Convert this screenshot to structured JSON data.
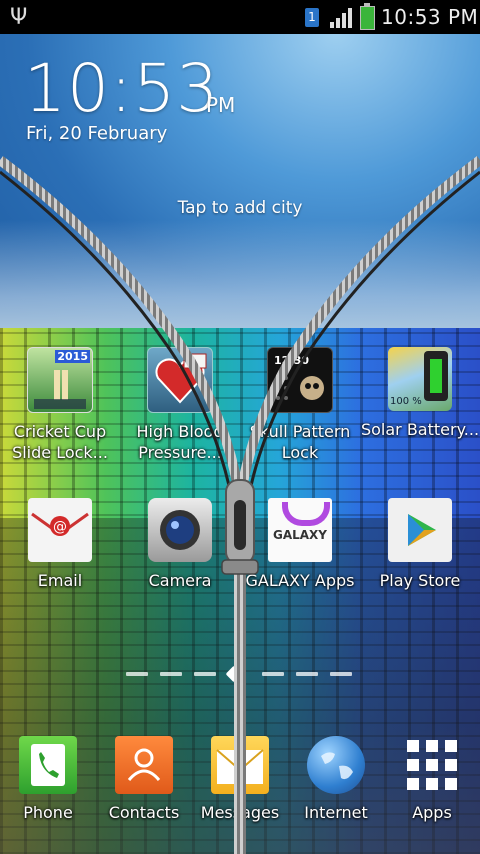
{
  "statusbar": {
    "time": "10:53 PM",
    "sim": "1"
  },
  "clock": {
    "time": "10:53",
    "ampm": "PM",
    "date": "Fri, 20 February"
  },
  "weather": {
    "prompt": "Tap to add city"
  },
  "apps_row1": [
    {
      "label": "Cricket Cup Slide Lock...",
      "badge": "2015",
      "icon": "cricket-icon"
    },
    {
      "label": "High Blood Pressure...",
      "icon": "heart-icon"
    },
    {
      "label": "Skull Pattern Lock",
      "badge": "12:30",
      "icon": "skull-icon"
    },
    {
      "label": "Solar Battery...",
      "badge": "100 %",
      "icon": "solar-battery-icon"
    }
  ],
  "apps_row2": [
    {
      "label": "Email",
      "icon": "email-icon"
    },
    {
      "label": "Camera",
      "icon": "camera-icon"
    },
    {
      "label": "GALAXY Apps",
      "badge": "GALAXY",
      "icon": "galaxy-apps-icon"
    },
    {
      "label": "Play Store",
      "icon": "play-store-icon"
    }
  ],
  "dock": [
    {
      "label": "Phone",
      "icon": "phone-icon"
    },
    {
      "label": "Contacts",
      "icon": "contacts-icon"
    },
    {
      "label": "Messages",
      "icon": "messages-icon"
    },
    {
      "label": "Internet",
      "icon": "globe-icon"
    },
    {
      "label": "Apps",
      "icon": "apps-grid-icon"
    }
  ],
  "colors": {
    "sky": "#2b6fb6",
    "statusbar": "#000000",
    "battery": "#3bb53b"
  }
}
